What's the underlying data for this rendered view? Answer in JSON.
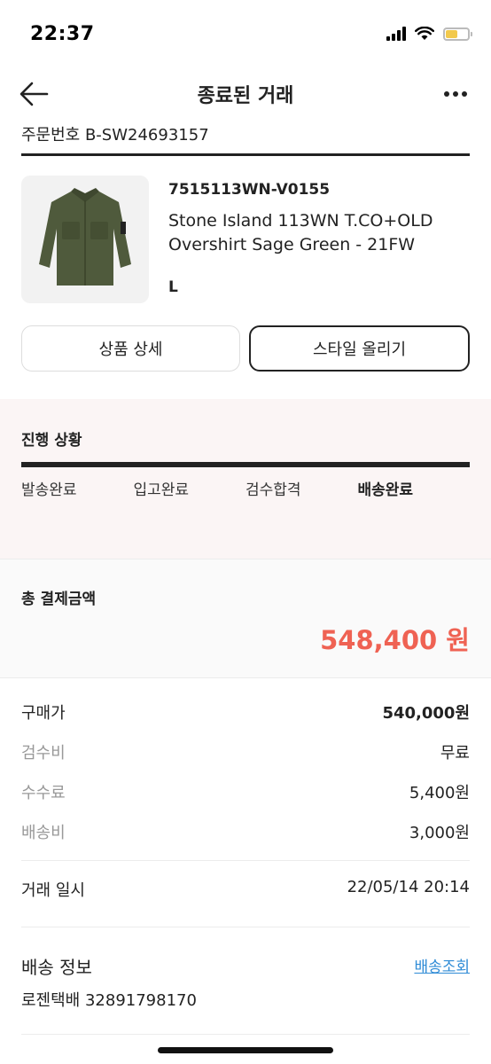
{
  "status_bar": {
    "time": "22:37"
  },
  "header": {
    "title": "종료된 거래"
  },
  "order": {
    "number": "주문번호 B-SW24693157"
  },
  "product": {
    "code": "7515113WN-V0155",
    "name": "Stone Island 113WN T.CO+OLD Overshirt Sage Green - 21FW",
    "size": "L"
  },
  "buttons": {
    "detail": "상품 상세",
    "style_upload": "스타일 올리기"
  },
  "progress": {
    "title": "진행 상황",
    "steps": [
      "발송완료",
      "입고완료",
      "검수합격",
      "배송완료"
    ],
    "active_index": 3
  },
  "total": {
    "label": "총 결제금액",
    "amount": "548,400 원",
    "color": "#ef6253"
  },
  "costs": [
    {
      "label": "구매가",
      "value": "540,000원"
    },
    {
      "label": "검수비",
      "value": "무료"
    },
    {
      "label": "수수료",
      "value": "5,400원"
    },
    {
      "label": "배송비",
      "value": "3,000원"
    }
  ],
  "trade": {
    "label": "거래 일시",
    "value": "22/05/14 20:14"
  },
  "shipping": {
    "title": "배송 정보",
    "link": "배송조회",
    "tracking": "로젠택배 32891798170"
  },
  "colors": {
    "accent": "#ef6253",
    "link": "#2e8bd6",
    "progress_bg": "#fbf5f5"
  }
}
